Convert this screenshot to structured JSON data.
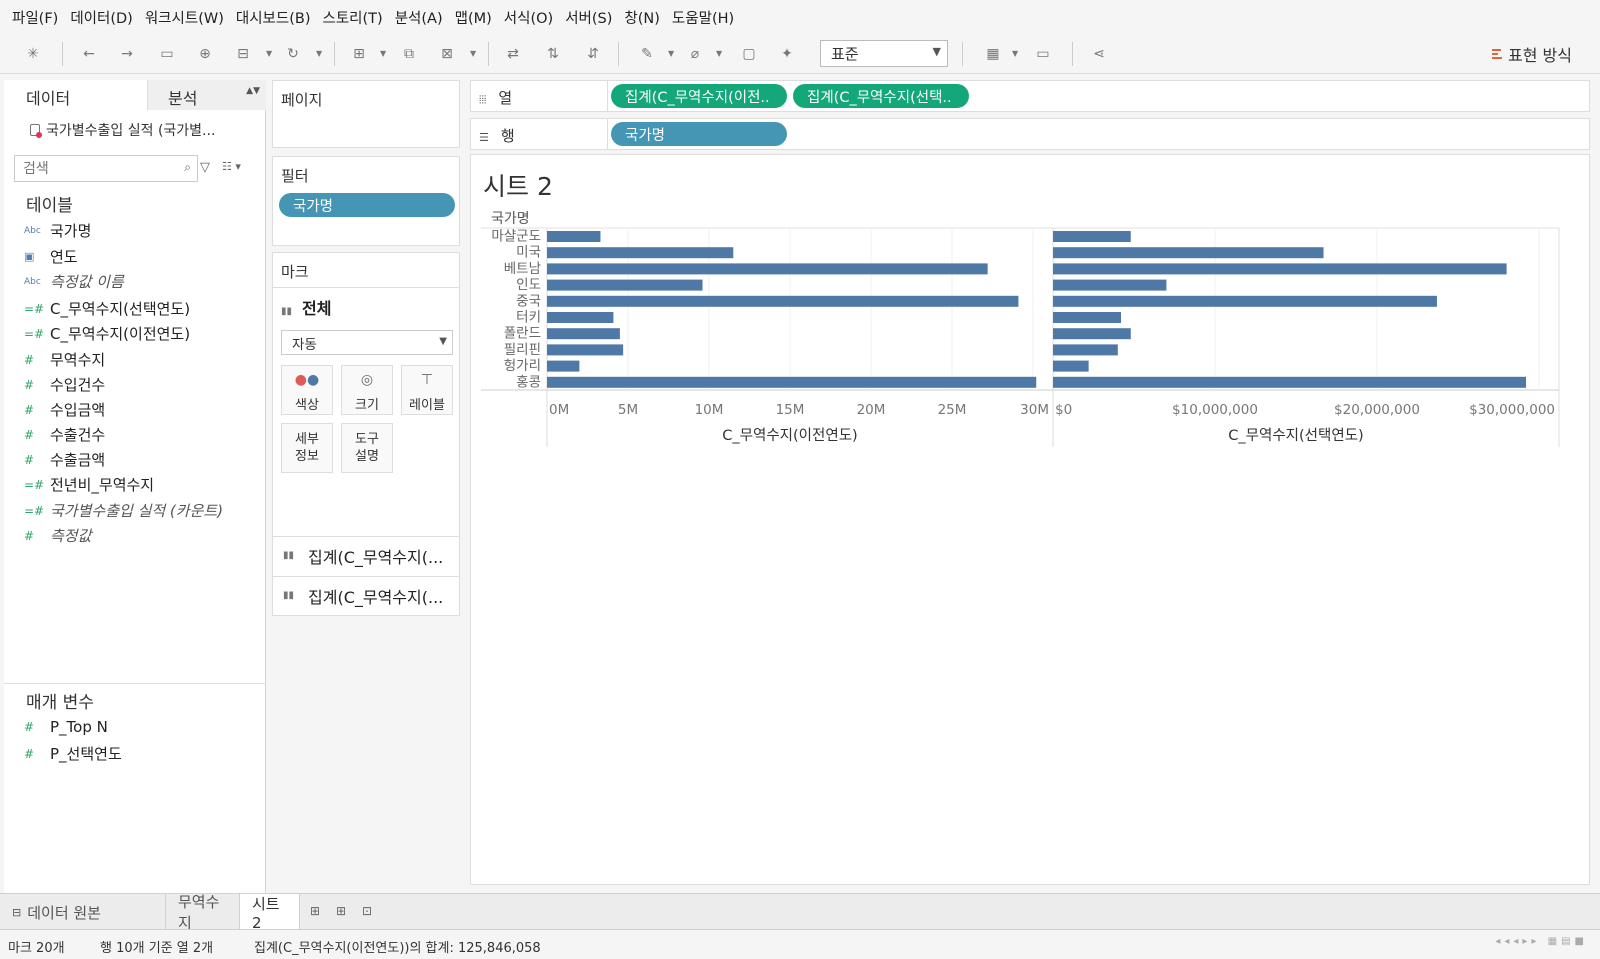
{
  "menu": [
    "파일(F)",
    "데이터(D)",
    "워크시트(W)",
    "대시보드(B)",
    "스토리(T)",
    "분석(A)",
    "맵(M)",
    "서식(O)",
    "서버(S)",
    "창(N)",
    "도움말(H)"
  ],
  "toolbar": {
    "fit": "표준",
    "show_me": "표현 방식"
  },
  "data_pane": {
    "tab_data": "데이터",
    "tab_analysis": "분석",
    "datasource": "국가별수출입 실적 (국가별...",
    "search_placeholder": "검색",
    "tables_heading": "테이블",
    "fields": [
      {
        "icon": "Abc",
        "label": "국가명"
      },
      {
        "icon": "calendar",
        "label": "연도"
      },
      {
        "icon": "Abc",
        "label": "측정값 이름"
      },
      {
        "icon": "=#",
        "label": "C_무역수지(선택연도)"
      },
      {
        "icon": "=#",
        "label": "C_무역수지(이전연도)"
      },
      {
        "icon": "#",
        "label": "무역수지"
      },
      {
        "icon": "#",
        "label": "수입건수"
      },
      {
        "icon": "#",
        "label": "수입금액"
      },
      {
        "icon": "#",
        "label": "수출건수"
      },
      {
        "icon": "#",
        "label": "수출금액"
      },
      {
        "icon": "=#",
        "label": "전년비_무역수지"
      },
      {
        "icon": "=#",
        "label": "국가별수출입 실적 (카운트)"
      },
      {
        "icon": "#",
        "label": "측정값"
      }
    ],
    "params_heading": "매개 변수",
    "params": [
      {
        "icon": "#",
        "label": "P_Top N"
      },
      {
        "icon": "#",
        "label": "P_선택연도"
      }
    ]
  },
  "shelves": {
    "pages": "페이지",
    "filters": "필터",
    "filter_pill": "국가명",
    "marks": "마크",
    "marks_all": "전체",
    "mark_type": "자동",
    "mark_buttons": [
      "색상",
      "크기",
      "레이블",
      "세부\n정보",
      "도구\n설명"
    ],
    "marks_measures": [
      "집계(C_무역수지(...",
      "집계(C_무역수지(..."
    ],
    "columns_label": "열",
    "columns_pills": [
      "집계(C_무역수지(이전..",
      "집계(C_무역수지(선택.."
    ],
    "rows_label": "행",
    "rows_pills": [
      "국가명"
    ]
  },
  "sheet_title": "시트 2",
  "chart_data": {
    "type": "bar",
    "row_header": "국가명",
    "categories": [
      "마샬군도",
      "미국",
      "베트남",
      "인도",
      "중국",
      "터키",
      "폴란드",
      "필리핀",
      "헝가리",
      "홍콩"
    ],
    "panes": [
      {
        "measure": "C_무역수지(이전연도)",
        "values": [
          3300000,
          11500000,
          27200000,
          9600000,
          29100000,
          4100000,
          4500000,
          4700000,
          2000000,
          30200000
        ],
        "xlim": [
          0,
          30000000
        ],
        "ticks": [
          0,
          5000000,
          10000000,
          15000000,
          20000000,
          25000000,
          30000000
        ],
        "tick_labels": [
          "0M",
          "5M",
          "10M",
          "15M",
          "20M",
          "25M",
          "30M"
        ]
      },
      {
        "measure": "C_무역수지(선택연도)",
        "values": [
          4800000,
          16700000,
          28000000,
          7000000,
          23700000,
          4200000,
          4800000,
          4000000,
          2200000,
          29200000
        ],
        "xlim": [
          0,
          30000000
        ],
        "ticks": [
          0,
          10000000,
          20000000,
          30000000
        ],
        "tick_labels": [
          "$0",
          "$10,000,000",
          "$20,000,000",
          "$30,000,000"
        ]
      }
    ],
    "bar_color": "#4e79a7"
  },
  "sheet_tabs": {
    "datasource_tab": "데이터 원본",
    "tabs": [
      "무역수지",
      "시트 2"
    ]
  },
  "status": {
    "marks": "마크 20개",
    "rows_cols": "행 10개 기준 열 2개",
    "sum": "집계(C_무역수지(이전연도))의 합계: 125,846,058"
  }
}
